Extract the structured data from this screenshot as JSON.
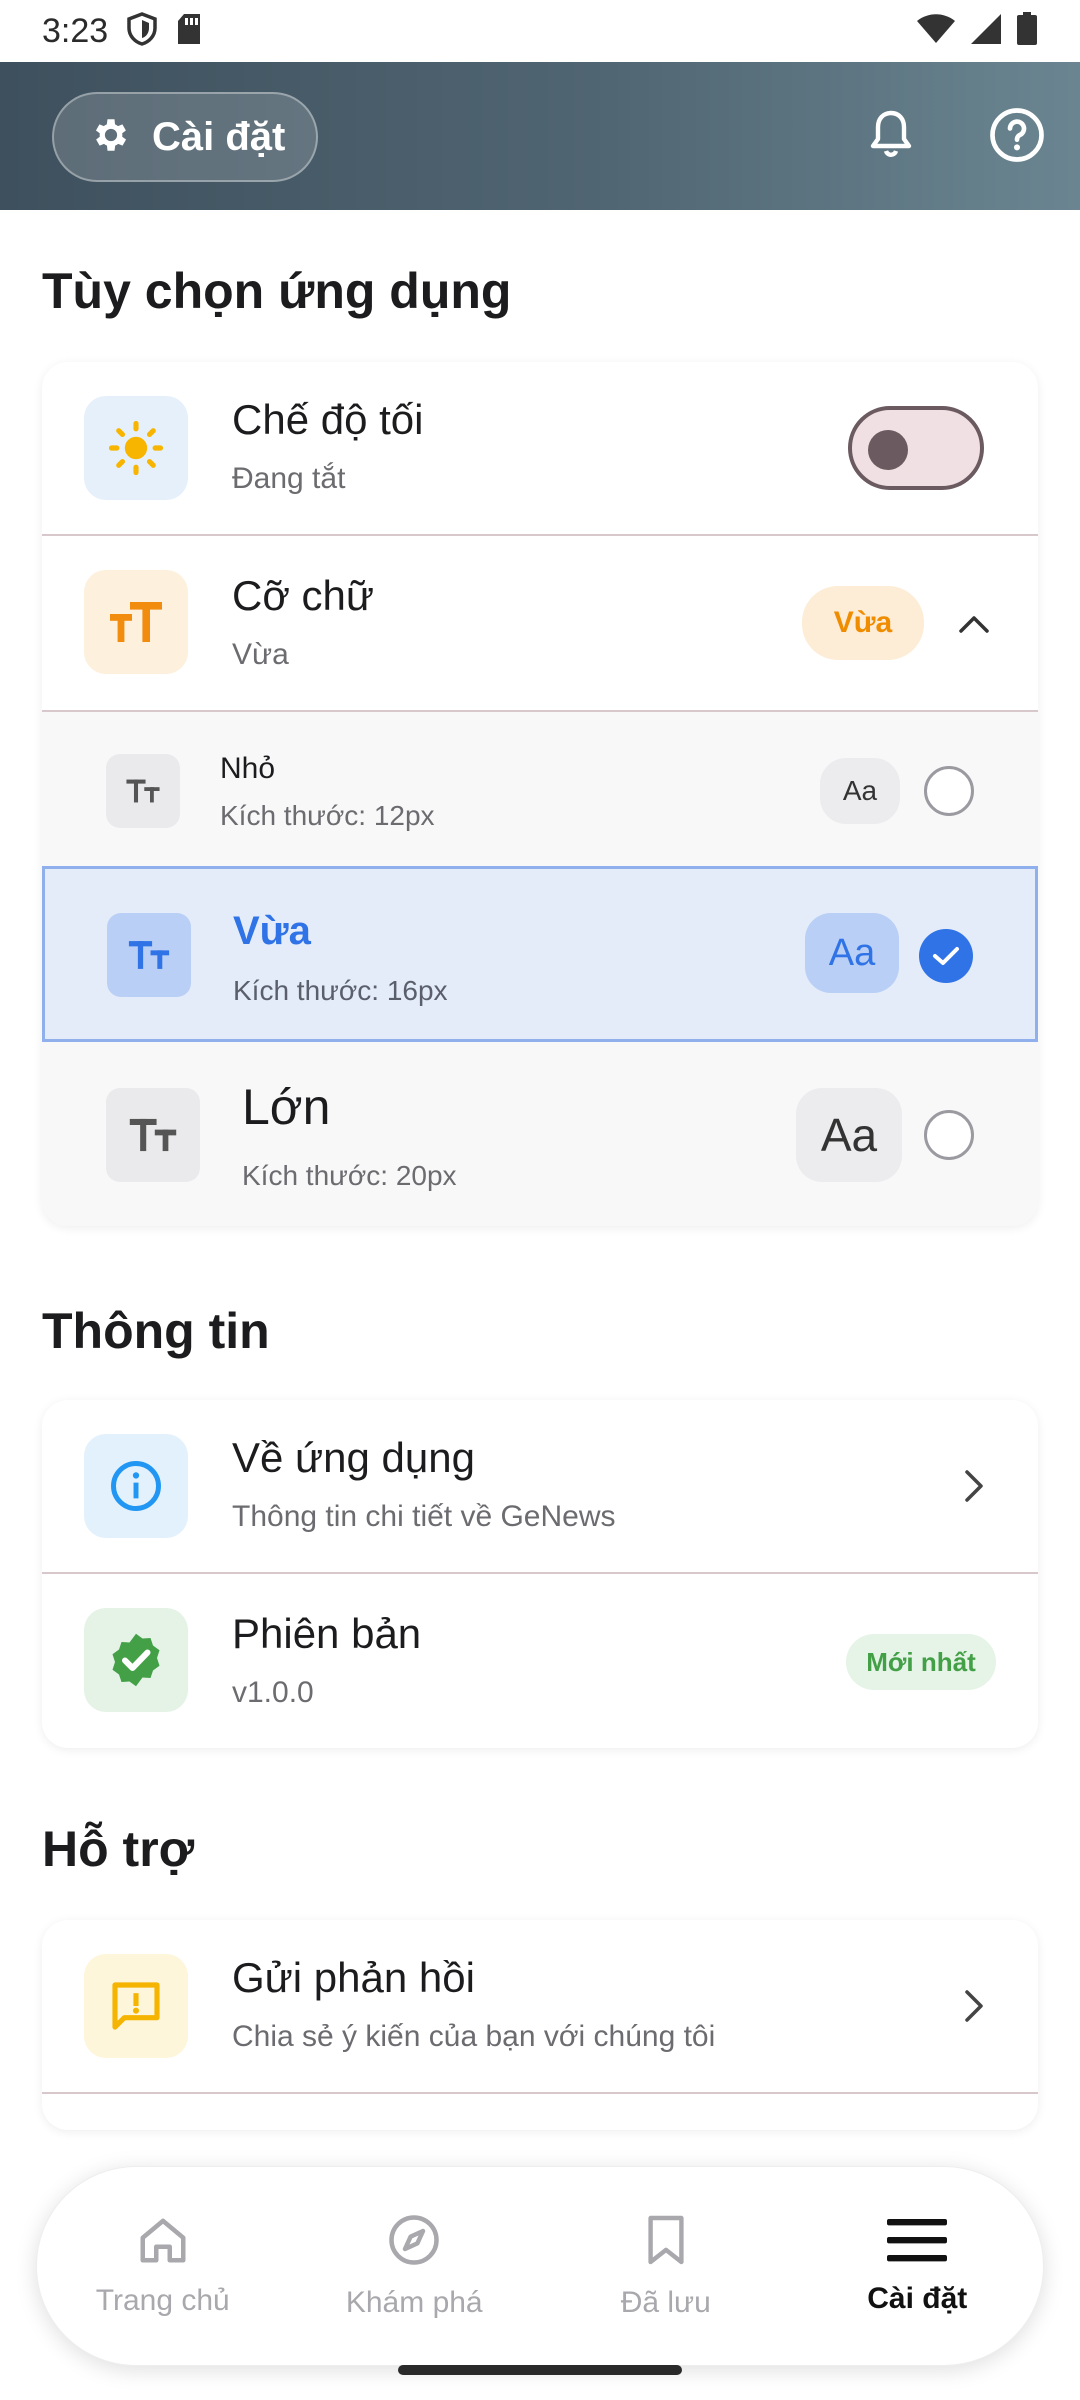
{
  "status_bar": {
    "time": "3:23"
  },
  "header": {
    "settings_label": "Cài đặt"
  },
  "sections": {
    "app_options": "Tùy chọn ứng dụng",
    "info": "Thông tin",
    "support": "Hỗ trợ"
  },
  "dark_mode": {
    "title": "Chế độ tối",
    "subtitle": "Đang tắt",
    "enabled": false
  },
  "font_size": {
    "title": "Cỡ chữ",
    "subtitle": "Vừa",
    "badge": "Vừa",
    "options": [
      {
        "label": "Nhỏ",
        "size_text": "Kích thước: 12px",
        "preview": "Aa",
        "selected": false
      },
      {
        "label": "Vừa",
        "size_text": "Kích thước: 16px",
        "preview": "Aa",
        "selected": true
      },
      {
        "label": "Lớn",
        "size_text": "Kích thước: 20px",
        "preview": "Aa",
        "selected": false
      }
    ]
  },
  "about": {
    "title": "Về ứng dụng",
    "subtitle": "Thông tin chi tiết về GeNews"
  },
  "version": {
    "title": "Phiên bản",
    "subtitle": "v1.0.0",
    "badge": "Mới nhất"
  },
  "feedback": {
    "title": "Gửi phản hồi",
    "subtitle": "Chia sẻ ý kiến của bạn với chúng tôi"
  },
  "bottom_nav": {
    "items": [
      {
        "label": "Trang chủ",
        "icon": "home-icon",
        "active": false
      },
      {
        "label": "Khám phá",
        "icon": "compass-icon",
        "active": false
      },
      {
        "label": "Đã lưu",
        "icon": "bookmark-icon",
        "active": false
      },
      {
        "label": "Cài đặt",
        "icon": "menu-icon",
        "active": true
      }
    ]
  },
  "colors": {
    "accent_blue": "#2f73e6",
    "orange": "#f59e0b",
    "green": "#43a047",
    "yellow": "#f5c518"
  }
}
